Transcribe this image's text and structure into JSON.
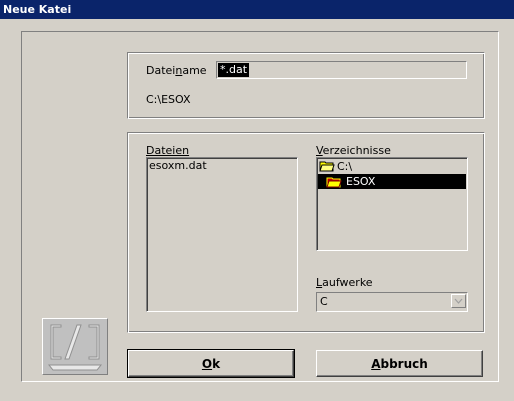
{
  "window": {
    "title": "Neue Katei"
  },
  "filename": {
    "label_pre": "Datei",
    "label_u": "n",
    "label_post": "ame",
    "value": "*.dat"
  },
  "current_path": "C:\\ESOX",
  "files": {
    "label": "Dateien",
    "items": [
      "esoxm.dat"
    ]
  },
  "directories": {
    "label_u": "V",
    "label_post": "erzeichnisse",
    "items": [
      {
        "label": "C:\\",
        "icon": "folder-open-icon",
        "selected": false
      },
      {
        "label": "ESOX",
        "icon": "folder-open-icon",
        "selected": true
      }
    ]
  },
  "drives": {
    "label_u": "L",
    "label_post": "aufwerke",
    "value": "C"
  },
  "buttons": {
    "ok_u": "O",
    "ok_post": "k",
    "cancel_u": "A",
    "cancel_post": "bbruch"
  },
  "colors": {
    "titlebar": "#0a246a",
    "selection": "#000000",
    "face": "#d4d0c8"
  }
}
